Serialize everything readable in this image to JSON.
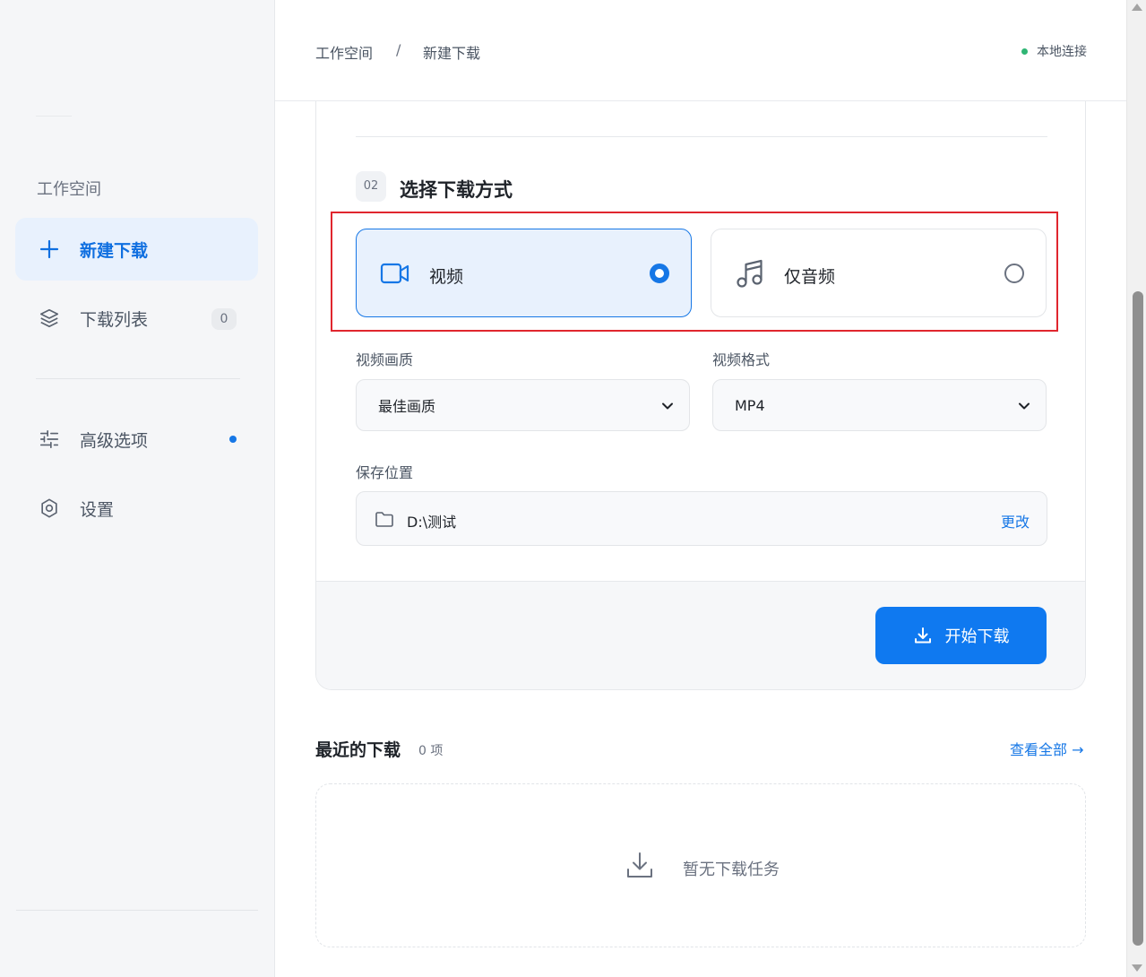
{
  "sidebar": {
    "section_label": "工作空间",
    "items": [
      {
        "label": "新建下载",
        "icon": "plus-icon",
        "active": true
      },
      {
        "label": "下载列表",
        "icon": "layers-icon",
        "badge": "0"
      },
      {
        "label": "高级选项",
        "icon": "sliders-icon",
        "has_dot": true
      },
      {
        "label": "设置",
        "icon": "gear-icon"
      }
    ]
  },
  "header": {
    "breadcrumb": [
      "工作空间",
      "/",
      "新建下载"
    ],
    "status": "本地连接",
    "status_color": "#2fb574"
  },
  "card": {
    "step": {
      "number": "02",
      "title": "选择下载方式"
    },
    "options": [
      {
        "label": "视频",
        "icon": "video-camera-icon",
        "selected": true
      },
      {
        "label": "仅音频",
        "icon": "music-note-icon",
        "selected": false
      }
    ],
    "quality": {
      "label": "视频画质",
      "value": "最佳画质"
    },
    "format": {
      "label": "视频格式",
      "value": "MP4"
    },
    "save": {
      "label": "保存位置",
      "path": "D:\\测试",
      "change": "更改"
    },
    "start_button": "开始下载"
  },
  "recent": {
    "title": "最近的下载",
    "count": "0 项",
    "view_all": "查看全部 →",
    "empty": "暂无下载任务"
  },
  "colors": {
    "accent": "#1677e6",
    "highlight": "#e0262e"
  }
}
